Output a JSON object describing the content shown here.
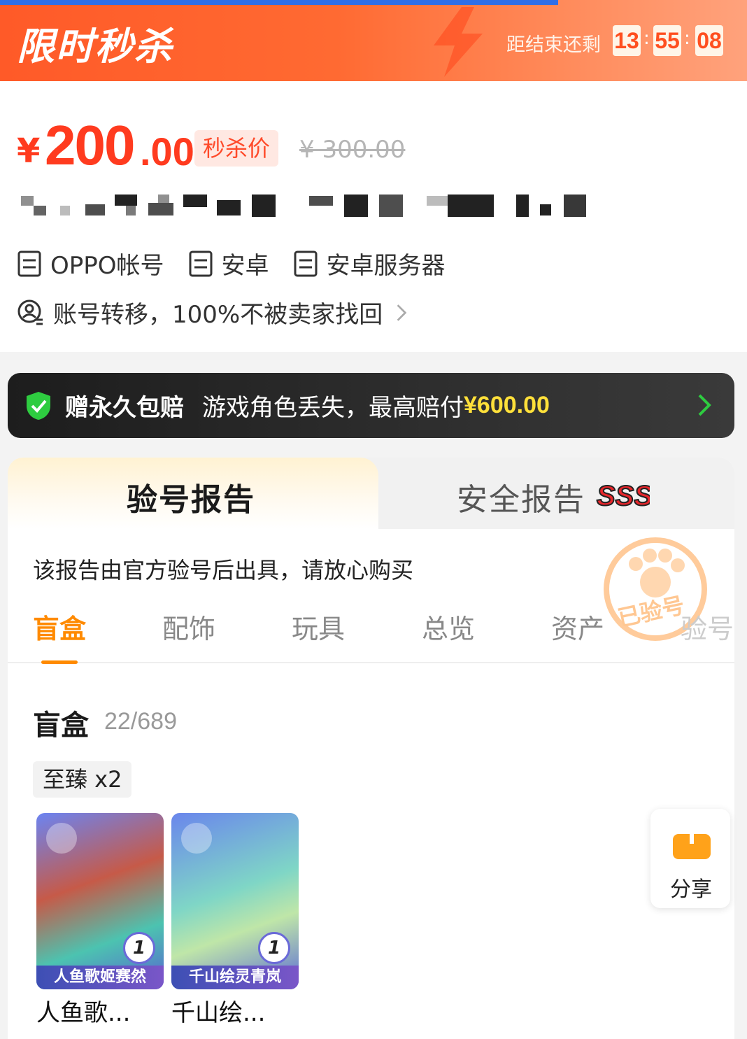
{
  "banner": {
    "title": "限时秒杀",
    "countdown_label": "距结束还剩",
    "hours": "13",
    "minutes": "55",
    "seconds": "08",
    "separator": ":"
  },
  "price": {
    "currency": "¥",
    "integer": "200",
    "decimal": ".00",
    "tag": "秒杀价",
    "original": "¥ 300.00"
  },
  "tags": [
    "OPPO帐号",
    "安卓",
    "安卓服务器"
  ],
  "transfer_text": "账号转移，100%不被卖家找回",
  "guarantee": {
    "title": "赠永久包赔",
    "text": "游戏角色丢失，最高赔付",
    "amount": "¥600.00"
  },
  "report": {
    "tab_active": "验号报告",
    "tab_inactive": "安全报告",
    "note": "该报告由官方验号后出具，请放心购买",
    "stamp_text": "已验号",
    "subtabs": [
      "盲盒",
      "配饰",
      "玩具",
      "总览",
      "资产",
      "验号"
    ],
    "section_title": "盲盒",
    "section_count": "22/689",
    "rarity": "至臻 x2",
    "items": [
      {
        "caption": "人鱼歌姬赛然",
        "name": "人鱼歌...",
        "count": "1"
      },
      {
        "caption": "千山绘灵青岚",
        "name": "千山绘...",
        "count": "1"
      }
    ]
  },
  "share": {
    "label": "分享"
  },
  "colors": {
    "accent": "#ff3b1f",
    "orange": "#ff8a00",
    "gold": "#ffe03a",
    "banner": "#ff5a28"
  }
}
